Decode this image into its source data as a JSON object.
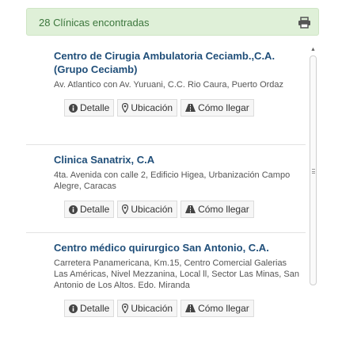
{
  "results": {
    "count_label": "28 Clínicas encontradas"
  },
  "icons": {
    "print": "print-icon",
    "info": "info-circle-icon",
    "location": "map-marker-icon",
    "directions": "road-icon"
  },
  "colors": {
    "alert_bg": "#dff0d8",
    "alert_text": "#3c763d",
    "title": "#1f4e79"
  },
  "clinics": [
    {
      "name": "Centro de Cirugia Ambulatoria Ceciamb.,C.A. (Grupo Ceciamb)",
      "address": "Av. Atlantico con Av. Yuruani, C.C. Rio Caura, Puerto Ordaz",
      "detail_label": "Detalle",
      "location_label": "Ubicación",
      "directions_label": "Cómo llegar"
    },
    {
      "name": "Clinica Sanatrix, C.A",
      "address": "4ta. Avenida con calle 2, Edificio Higea, Urbanización Campo Alegre, Caracas",
      "detail_label": "Detalle",
      "location_label": "Ubicación",
      "directions_label": "Cómo llegar"
    },
    {
      "name": "Centro médico quirurgico San Antonio, C.A.",
      "address": "Carretera Panamericana, Km.15, Centro Comercial Galerias Las Américas, Nivel Mezzanina, Local ll, Sector Las Minas, San Antonio de Los Altos. Edo. Miranda",
      "detail_label": "Detalle",
      "location_label": "Ubicación",
      "directions_label": "Cómo llegar"
    }
  ]
}
